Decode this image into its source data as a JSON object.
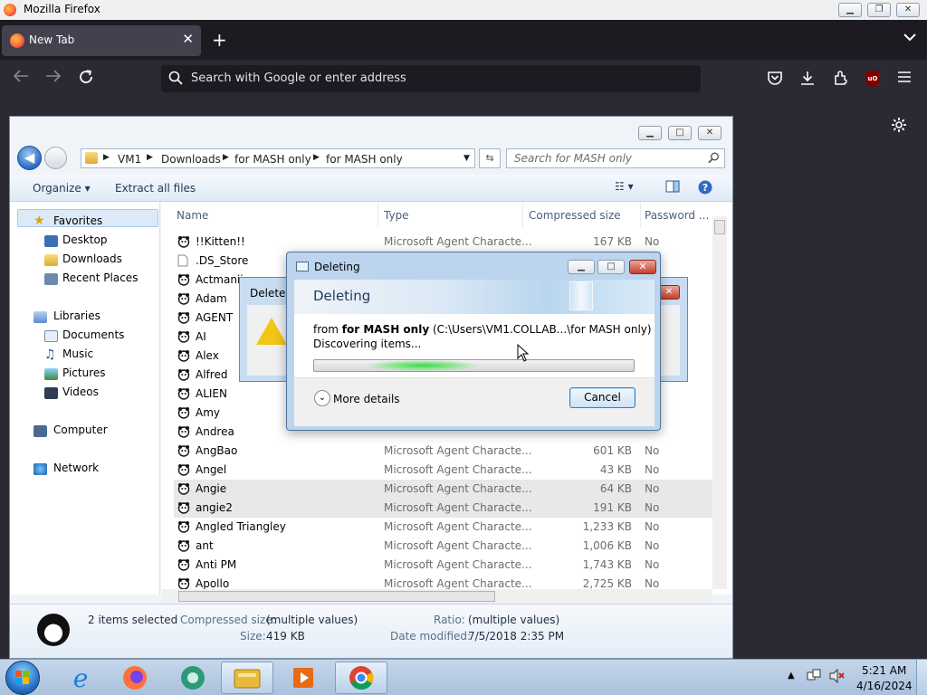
{
  "firefox": {
    "window_title": "Mozilla Firefox",
    "tab_label": "New Tab",
    "url_placeholder": "Search with Google or enter address",
    "ublock_label": "uO"
  },
  "explorer": {
    "breadcrumbs": [
      "VM1",
      "Downloads",
      "for MASH only",
      "for MASH only"
    ],
    "search_placeholder": "Search for MASH only",
    "commands": {
      "organize": "Organize",
      "extract_all": "Extract all files"
    },
    "nav": {
      "favorites": "Favorites",
      "desktop": "Desktop",
      "downloads": "Downloads",
      "recent_places": "Recent Places",
      "libraries": "Libraries",
      "documents": "Documents",
      "music": "Music",
      "pictures": "Pictures",
      "videos": "Videos",
      "computer": "Computer",
      "network": "Network"
    },
    "columns": {
      "name": "Name",
      "type": "Type",
      "compressed_size": "Compressed size",
      "password": "Password ..."
    },
    "files": [
      {
        "name": "!!Kitten!!",
        "type": "Microsoft Agent Characte...",
        "size": "167 KB",
        "password": "No"
      },
      {
        "name": ".DS_Store",
        "type": "",
        "size": "",
        "password": ""
      },
      {
        "name": "Actmanii",
        "type": "",
        "size": "",
        "password": ""
      },
      {
        "name": "Adam",
        "type": "",
        "size": "",
        "password": ""
      },
      {
        "name": "AGENT",
        "type": "",
        "size": "",
        "password": ""
      },
      {
        "name": "AI",
        "type": "",
        "size": "",
        "password": ""
      },
      {
        "name": "Alex",
        "type": "",
        "size": "",
        "password": ""
      },
      {
        "name": "Alfred",
        "type": "",
        "size": "",
        "password": ""
      },
      {
        "name": "ALIEN",
        "type": "",
        "size": "",
        "password": ""
      },
      {
        "name": "Amy",
        "type": "",
        "size": "",
        "password": ""
      },
      {
        "name": "Andrea",
        "type": "",
        "size": "",
        "password": ""
      },
      {
        "name": "AngBao",
        "type": "Microsoft Agent Characte...",
        "size": "601 KB",
        "password": "No"
      },
      {
        "name": "Angel",
        "type": "Microsoft Agent Characte...",
        "size": "43 KB",
        "password": "No"
      },
      {
        "name": "Angie",
        "type": "Microsoft Agent Characte...",
        "size": "64 KB",
        "password": "No"
      },
      {
        "name": "angie2",
        "type": "Microsoft Agent Characte...",
        "size": "191 KB",
        "password": "No"
      },
      {
        "name": "Angled Triangley",
        "type": "Microsoft Agent Characte...",
        "size": "1,233 KB",
        "password": "No"
      },
      {
        "name": "ant",
        "type": "Microsoft Agent Characte...",
        "size": "1,006 KB",
        "password": "No"
      },
      {
        "name": "Anti PM",
        "type": "Microsoft Agent Characte...",
        "size": "1,743 KB",
        "password": "No"
      },
      {
        "name": "Apollo",
        "type": "Microsoft Agent Characte...",
        "size": "2,725 KB",
        "password": "No"
      }
    ],
    "details": {
      "selected": "2 items selected",
      "compressed_label": "Compressed size:",
      "compressed_value": "(multiple values)",
      "size_label": "Size:",
      "size_value": "419 KB",
      "ratio_label": "Ratio:",
      "ratio_value": "(multiple values)",
      "date_label": "Date modified:",
      "date_value": "7/5/2018 2:35 PM"
    }
  },
  "delete_confirm": {
    "title_partial": "Delete M"
  },
  "deleting_dialog": {
    "caption": "Deleting",
    "heading": "Deleting",
    "from_prefix": "from",
    "from_folder": "for MASH only",
    "from_path": "(C:\\Users\\VM1.COLLAB...\\for MASH only)",
    "status": "Discovering items...",
    "more_details": "More details",
    "cancel": "Cancel"
  },
  "taskbar": {
    "time": "5:21 AM",
    "date": "4/16/2024"
  },
  "colors": {
    "firefox_dark": "#1c1b22",
    "firefox_toolbar": "#2b2a33",
    "progress_green": "#3fd64d"
  }
}
